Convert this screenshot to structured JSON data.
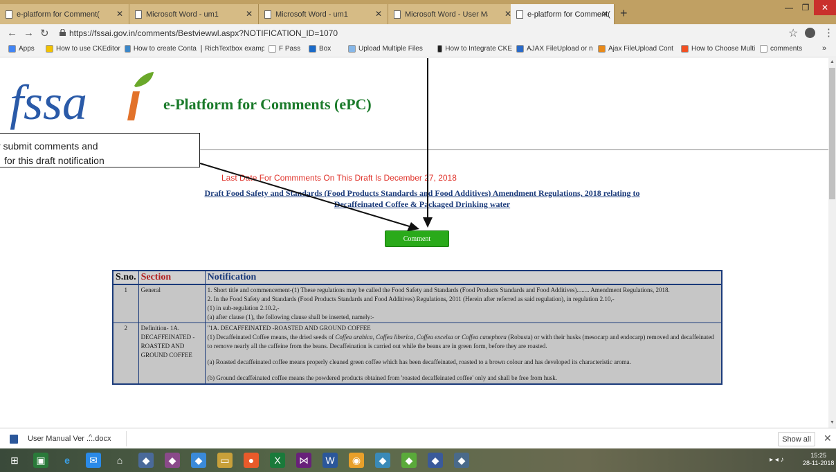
{
  "browser": {
    "tabs": [
      {
        "label": "e-platform for Comment(ePC)",
        "active": false
      },
      {
        "label": "Microsoft Word - um1",
        "active": false
      },
      {
        "label": "Microsoft Word - um1",
        "active": false
      },
      {
        "label": "Microsoft Word - User Manual V",
        "active": false
      },
      {
        "label": "e-platform for Comment(ePC)",
        "active": true
      }
    ],
    "new_tab": "+",
    "url": "https://fssai.gov.in/comments/Bestviewwl.aspx?NOTIFICATION_ID=1070",
    "bookmarks": [
      {
        "label": "Apps",
        "color": "#4285f4"
      },
      {
        "label": "How to use CKEditor",
        "color": "#f2c200"
      },
      {
        "label": "How to create Conta",
        "color": "#3a86c8"
      },
      {
        "label": "RichTextbox example",
        "color": "#d93025"
      },
      {
        "label": "F Pass",
        "color": "#ffffff"
      },
      {
        "label": "Box",
        "color": "#1a6ac8"
      },
      {
        "label": "Upload Multiple Files",
        "color": "#86b7e8"
      },
      {
        "label": "How to Integrate CKE",
        "color": "#222222"
      },
      {
        "label": "AJAX FileUpload or n",
        "color": "#2a6ac8"
      },
      {
        "label": "Ajax FileUpload Cont",
        "color": "#e88a1a"
      },
      {
        "label": "How to Choose Multi",
        "color": "#f25022"
      },
      {
        "label": "comments",
        "color": "#ffffff"
      }
    ],
    "more": "»"
  },
  "page": {
    "site_title": "e-Platform for Comments (ePC)",
    "logo_text": "fssai",
    "callout": {
      "line1": "r  submit comments and",
      "line2": "for this draft notification"
    },
    "last_date": "Last Date For Commments On This Draft Is December 27, 2018",
    "draft_title_line1": "Draft Food Safety and Standards (Food Products Standards and Food Additives) Amendment Regulations, 2018 relating to",
    "draft_title_line2": "Decaffeinated Coffee & Packaged Drinking water",
    "comment_button": "Comment",
    "table": {
      "headers": {
        "sno": "S.no.",
        "section": "Section",
        "notification": "Notification"
      },
      "rows": [
        {
          "sno": "1",
          "section": "General",
          "notification": [
            "1.    Short title and commencement-(1) These regulations may be called the Food Safety and Standards (Food Products Standards and Food Additives)........ Amendment Regulations, 2018.",
            "2.    In the Food Safety and Standards (Food Products Standards and Food Additives) Regulations, 2011 (Herein after referred as said regulation), in regulation 2.10,-",
            "(1) in sub-regulation 2.10.2,-",
            "(a)  after clause (1), the following clause shall be inserted, namely:-"
          ]
        },
        {
          "sno": "2",
          "section": "Definition- 1A. DECAFFEINATED - ROASTED AND GROUND COFFEE",
          "notification_head": "\"1A.  DECAFFEINATED -ROASTED AND GROUND COFFEE",
          "notification_p1_pre": "(1) Decaffeinated Coffee means, the dried seeds of ",
          "notification_p1_italic": "Coffea arabica, Coffea liberica, Coffea excelsa or Coffea canephora",
          "notification_p1_post": " (Robusta) or with their husks (mesocarp and endocarp) removed and decaffeinated to remove nearly all the caffeine from the beans. Decaffeination is carried out while the beans are in green form, before they are roasted.",
          "notification_p2": "(a) Roasted decaffeinated coffee means properly cleaned green coffee which has been decaffeinated, roasted to a brown colour and has developed its characteristic aroma.",
          "notification_p3": "(b) Ground decaffeinated coffee means the powdered products obtained from 'roasted decaffeinated coffee' only and shall be free from husk."
        }
      ]
    }
  },
  "downloads": {
    "file": "User Manual Ver ....docx",
    "chevron": "^",
    "show_all": "Show all",
    "close": "✕"
  },
  "taskbar": {
    "time": "15:25",
    "date": "28-11-2018"
  },
  "colors": {
    "title_green": "#1a7a2a",
    "deadline_red": "#e0332b",
    "link_blue": "#1a3a7a",
    "button_green": "#2aaa1a"
  }
}
